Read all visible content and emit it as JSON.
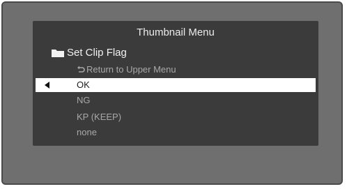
{
  "menu": {
    "title": "Thumbnail Menu",
    "heading": "Set Clip Flag",
    "return_label": "Return to Upper Menu",
    "options": [
      {
        "label": "OK",
        "selected": true
      },
      {
        "label": "NG",
        "selected": false
      },
      {
        "label": "KP (KEEP)",
        "selected": false
      },
      {
        "label": "none",
        "selected": false
      }
    ]
  },
  "icons": {
    "heading": "folder-icon",
    "return": "return-arrow-icon",
    "cursor": "cursor-arrow-icon"
  },
  "colors": {
    "screen_background": "#3b3b3b",
    "bezel": "#6f6f6f",
    "highlight": "#ffffff",
    "text": "#ececec",
    "dim_text": "#a8a8a8"
  }
}
